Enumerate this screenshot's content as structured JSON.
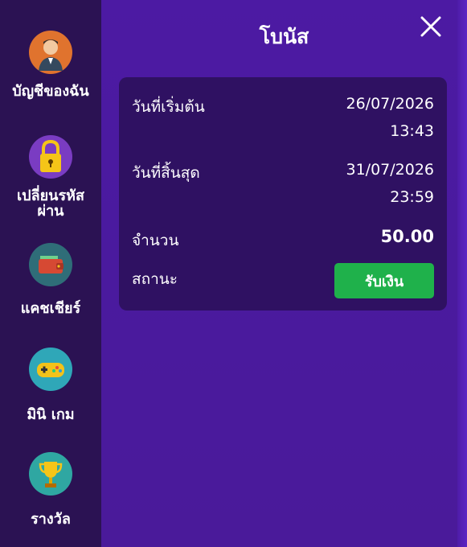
{
  "sidebar": {
    "items": [
      {
        "label": "บัญชีของฉัน",
        "icon": "user-avatar-icon"
      },
      {
        "label": "เปลี่ยนรหัสผ่าน",
        "icon": "padlock-icon"
      },
      {
        "label": "แคชเชียร์",
        "icon": "wallet-icon"
      },
      {
        "label": "มินิ เกม",
        "icon": "gamepad-icon"
      },
      {
        "label": "รางวัล",
        "icon": "trophy-icon"
      }
    ]
  },
  "header": {
    "title": "โบนัส",
    "close_icon": "close-icon"
  },
  "bonus": {
    "start_label": "วันที่เริ่มต้น",
    "start_date": "26/07/2026",
    "start_time": "13:43",
    "end_label": "วันที่สิ้นสุด",
    "end_date": "31/07/2026",
    "end_time": "23:59",
    "amount_label": "จำนวน",
    "amount": "50.00",
    "status_label": "สถานะ",
    "claim_button": "รับเงิน"
  },
  "colors": {
    "sidebar_bg": "#2b1253",
    "main_bg": "#4c1aa3",
    "card_bg": "#2f1162",
    "button_green": "#1fb14b"
  }
}
